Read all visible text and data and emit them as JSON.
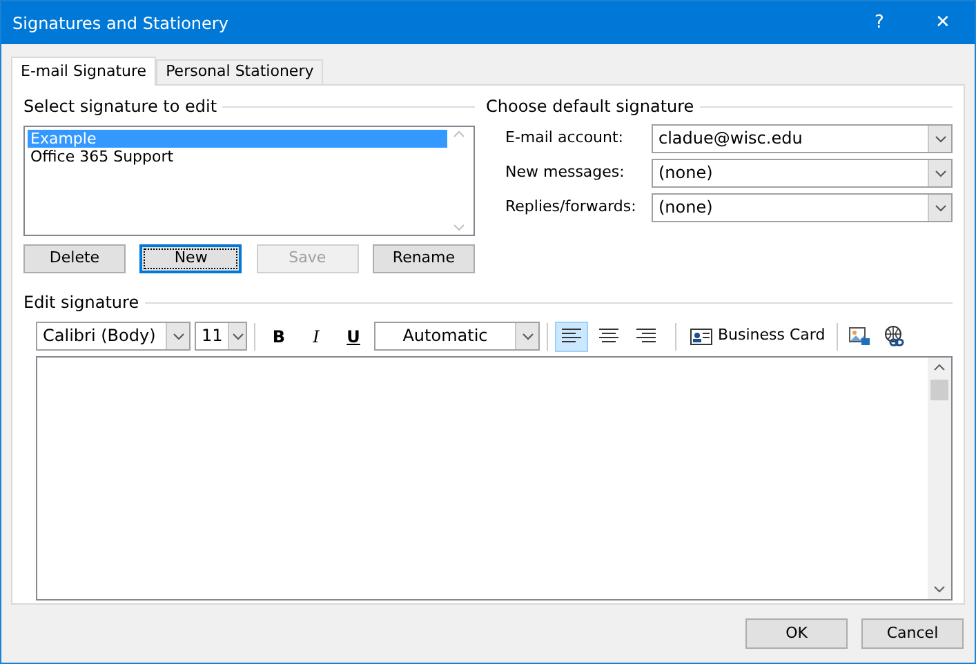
{
  "window": {
    "title": "Signatures and Stationery",
    "help": "?",
    "close": "✕"
  },
  "tabs": [
    {
      "label": "E-mail Signature",
      "selected": true
    },
    {
      "label": "Personal Stationery",
      "selected": false
    }
  ],
  "select_signature": {
    "heading": "Select signature to edit",
    "items": [
      {
        "label": "Example",
        "selected": true
      },
      {
        "label": "Office 365 Support",
        "selected": false
      }
    ],
    "buttons": [
      {
        "label": "Delete",
        "disabled": false,
        "focused": false
      },
      {
        "label": "New",
        "disabled": false,
        "focused": true
      },
      {
        "label": "Save",
        "disabled": true,
        "focused": false
      },
      {
        "label": "Rename",
        "disabled": false,
        "focused": false
      }
    ]
  },
  "default_signature": {
    "heading": "Choose default signature",
    "fields": [
      {
        "label": "E-mail account:",
        "value": "cladue@wisc.edu"
      },
      {
        "label": "New messages:",
        "value": "(none)"
      },
      {
        "label": "Replies/forwards:",
        "value": "(none)"
      }
    ]
  },
  "edit_signature": {
    "heading": "Edit signature",
    "font": "Calibri (Body)",
    "size": "11",
    "bold": "B",
    "italic": "I",
    "underline": "U",
    "font_color": "Automatic",
    "align": [
      {
        "kind": "left",
        "selected": true
      },
      {
        "kind": "center",
        "selected": false
      },
      {
        "kind": "right",
        "selected": false
      }
    ],
    "business_card": "Business Card"
  },
  "footer": {
    "buttons": [
      "OK",
      "Cancel"
    ]
  }
}
